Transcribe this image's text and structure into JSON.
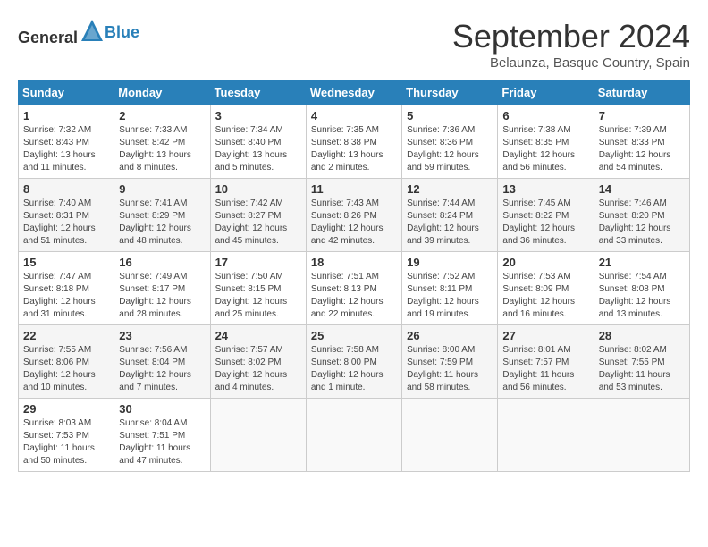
{
  "header": {
    "logo_general": "General",
    "logo_blue": "Blue",
    "month": "September 2024",
    "location": "Belaunza, Basque Country, Spain"
  },
  "weekdays": [
    "Sunday",
    "Monday",
    "Tuesday",
    "Wednesday",
    "Thursday",
    "Friday",
    "Saturday"
  ],
  "weeks": [
    [
      {
        "day": "1",
        "sunrise": "Sunrise: 7:32 AM",
        "sunset": "Sunset: 8:43 PM",
        "daylight": "Daylight: 13 hours and 11 minutes."
      },
      {
        "day": "2",
        "sunrise": "Sunrise: 7:33 AM",
        "sunset": "Sunset: 8:42 PM",
        "daylight": "Daylight: 13 hours and 8 minutes."
      },
      {
        "day": "3",
        "sunrise": "Sunrise: 7:34 AM",
        "sunset": "Sunset: 8:40 PM",
        "daylight": "Daylight: 13 hours and 5 minutes."
      },
      {
        "day": "4",
        "sunrise": "Sunrise: 7:35 AM",
        "sunset": "Sunset: 8:38 PM",
        "daylight": "Daylight: 13 hours and 2 minutes."
      },
      {
        "day": "5",
        "sunrise": "Sunrise: 7:36 AM",
        "sunset": "Sunset: 8:36 PM",
        "daylight": "Daylight: 12 hours and 59 minutes."
      },
      {
        "day": "6",
        "sunrise": "Sunrise: 7:38 AM",
        "sunset": "Sunset: 8:35 PM",
        "daylight": "Daylight: 12 hours and 56 minutes."
      },
      {
        "day": "7",
        "sunrise": "Sunrise: 7:39 AM",
        "sunset": "Sunset: 8:33 PM",
        "daylight": "Daylight: 12 hours and 54 minutes."
      }
    ],
    [
      {
        "day": "8",
        "sunrise": "Sunrise: 7:40 AM",
        "sunset": "Sunset: 8:31 PM",
        "daylight": "Daylight: 12 hours and 51 minutes."
      },
      {
        "day": "9",
        "sunrise": "Sunrise: 7:41 AM",
        "sunset": "Sunset: 8:29 PM",
        "daylight": "Daylight: 12 hours and 48 minutes."
      },
      {
        "day": "10",
        "sunrise": "Sunrise: 7:42 AM",
        "sunset": "Sunset: 8:27 PM",
        "daylight": "Daylight: 12 hours and 45 minutes."
      },
      {
        "day": "11",
        "sunrise": "Sunrise: 7:43 AM",
        "sunset": "Sunset: 8:26 PM",
        "daylight": "Daylight: 12 hours and 42 minutes."
      },
      {
        "day": "12",
        "sunrise": "Sunrise: 7:44 AM",
        "sunset": "Sunset: 8:24 PM",
        "daylight": "Daylight: 12 hours and 39 minutes."
      },
      {
        "day": "13",
        "sunrise": "Sunrise: 7:45 AM",
        "sunset": "Sunset: 8:22 PM",
        "daylight": "Daylight: 12 hours and 36 minutes."
      },
      {
        "day": "14",
        "sunrise": "Sunrise: 7:46 AM",
        "sunset": "Sunset: 8:20 PM",
        "daylight": "Daylight: 12 hours and 33 minutes."
      }
    ],
    [
      {
        "day": "15",
        "sunrise": "Sunrise: 7:47 AM",
        "sunset": "Sunset: 8:18 PM",
        "daylight": "Daylight: 12 hours and 31 minutes."
      },
      {
        "day": "16",
        "sunrise": "Sunrise: 7:49 AM",
        "sunset": "Sunset: 8:17 PM",
        "daylight": "Daylight: 12 hours and 28 minutes."
      },
      {
        "day": "17",
        "sunrise": "Sunrise: 7:50 AM",
        "sunset": "Sunset: 8:15 PM",
        "daylight": "Daylight: 12 hours and 25 minutes."
      },
      {
        "day": "18",
        "sunrise": "Sunrise: 7:51 AM",
        "sunset": "Sunset: 8:13 PM",
        "daylight": "Daylight: 12 hours and 22 minutes."
      },
      {
        "day": "19",
        "sunrise": "Sunrise: 7:52 AM",
        "sunset": "Sunset: 8:11 PM",
        "daylight": "Daylight: 12 hours and 19 minutes."
      },
      {
        "day": "20",
        "sunrise": "Sunrise: 7:53 AM",
        "sunset": "Sunset: 8:09 PM",
        "daylight": "Daylight: 12 hours and 16 minutes."
      },
      {
        "day": "21",
        "sunrise": "Sunrise: 7:54 AM",
        "sunset": "Sunset: 8:08 PM",
        "daylight": "Daylight: 12 hours and 13 minutes."
      }
    ],
    [
      {
        "day": "22",
        "sunrise": "Sunrise: 7:55 AM",
        "sunset": "Sunset: 8:06 PM",
        "daylight": "Daylight: 12 hours and 10 minutes."
      },
      {
        "day": "23",
        "sunrise": "Sunrise: 7:56 AM",
        "sunset": "Sunset: 8:04 PM",
        "daylight": "Daylight: 12 hours and 7 minutes."
      },
      {
        "day": "24",
        "sunrise": "Sunrise: 7:57 AM",
        "sunset": "Sunset: 8:02 PM",
        "daylight": "Daylight: 12 hours and 4 minutes."
      },
      {
        "day": "25",
        "sunrise": "Sunrise: 7:58 AM",
        "sunset": "Sunset: 8:00 PM",
        "daylight": "Daylight: 12 hours and 1 minute."
      },
      {
        "day": "26",
        "sunrise": "Sunrise: 8:00 AM",
        "sunset": "Sunset: 7:59 PM",
        "daylight": "Daylight: 11 hours and 58 minutes."
      },
      {
        "day": "27",
        "sunrise": "Sunrise: 8:01 AM",
        "sunset": "Sunset: 7:57 PM",
        "daylight": "Daylight: 11 hours and 56 minutes."
      },
      {
        "day": "28",
        "sunrise": "Sunrise: 8:02 AM",
        "sunset": "Sunset: 7:55 PM",
        "daylight": "Daylight: 11 hours and 53 minutes."
      }
    ],
    [
      {
        "day": "29",
        "sunrise": "Sunrise: 8:03 AM",
        "sunset": "Sunset: 7:53 PM",
        "daylight": "Daylight: 11 hours and 50 minutes."
      },
      {
        "day": "30",
        "sunrise": "Sunrise: 8:04 AM",
        "sunset": "Sunset: 7:51 PM",
        "daylight": "Daylight: 11 hours and 47 minutes."
      },
      null,
      null,
      null,
      null,
      null
    ]
  ]
}
